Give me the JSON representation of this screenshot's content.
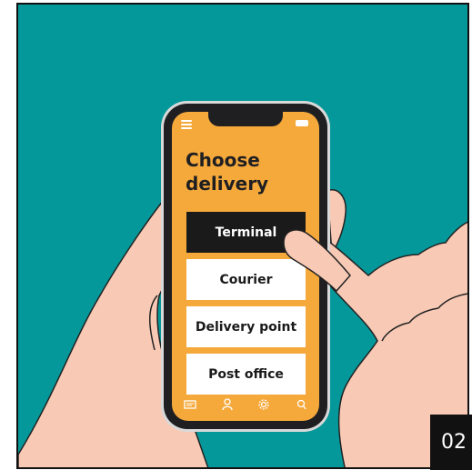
{
  "screen": {
    "title": "Choose\ndelivery",
    "options": [
      {
        "label": "Terminal",
        "selected": true
      },
      {
        "label": "Courier",
        "selected": false
      },
      {
        "label": "Delivery point",
        "selected": false
      },
      {
        "label": "Post office",
        "selected": false
      }
    ],
    "nav_icons": [
      "chat-icon",
      "user-icon",
      "settings-icon",
      "location-icon"
    ]
  },
  "badge": {
    "text": "02"
  },
  "colors": {
    "background": "#05989a",
    "screen": "#f6a93b",
    "skin": "#f8c9b5",
    "selected": "#1a1a1a"
  }
}
